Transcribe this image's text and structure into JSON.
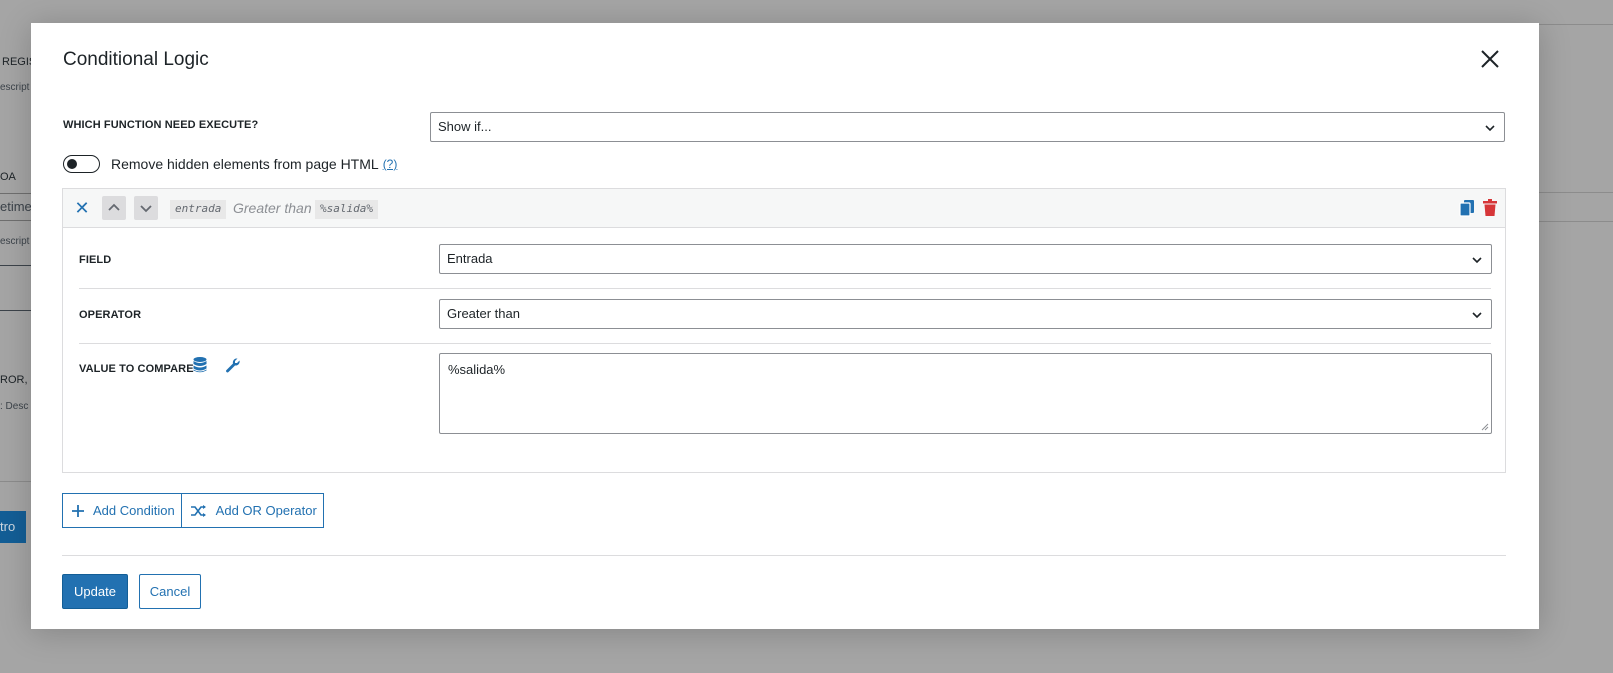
{
  "background": {
    "frag_regis": "REGIS",
    "frag_descript_1": "escript",
    "frag_oa": "OA",
    "frag_input": "etime",
    "frag_descript_2": "escript",
    "frag_ror": "ROR, L",
    "frag_desc": ":   Desc",
    "frag_button": "tro"
  },
  "modal": {
    "title": "Conditional Logic",
    "function_label": "WHICH FUNCTION NEED EXECUTE?",
    "function_value": "Show if...",
    "toggle_label": "Remove hidden elements from page HTML",
    "toggle_help": "(?)",
    "toggle_on": false
  },
  "condition": {
    "summary_field": "entrada",
    "summary_operator": "Greater than",
    "summary_value": "%salida%",
    "field_label": "FIELD",
    "field_value": "Entrada",
    "operator_label": "OPERATOR",
    "operator_value": "Greater than",
    "value_label": "VALUE TO COMPARE",
    "value_text": "%salida%"
  },
  "actions": {
    "add_condition": "Add Condition",
    "add_or": "Add OR Operator",
    "update": "Update",
    "cancel": "Cancel"
  },
  "colors": {
    "accent": "#2271b1",
    "danger": "#d63638",
    "overlay": "#a5a5a5"
  }
}
